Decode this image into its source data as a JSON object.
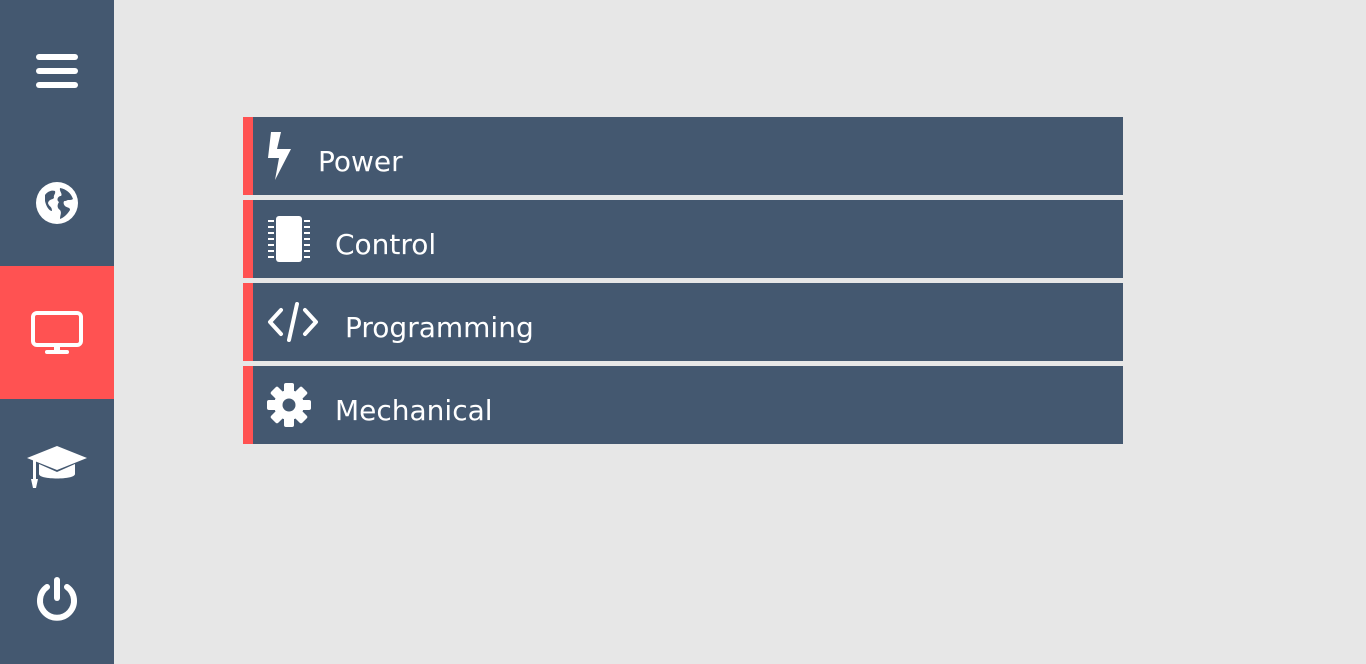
{
  "sidebar": {
    "items": [
      {
        "icon": "hamburger-menu-icon",
        "active": false
      },
      {
        "icon": "globe-icon",
        "active": false
      },
      {
        "icon": "monitor-icon",
        "active": true
      },
      {
        "icon": "graduation-cap-icon",
        "active": false
      },
      {
        "icon": "power-icon",
        "active": false
      }
    ]
  },
  "menu": {
    "items": [
      {
        "label": "Power",
        "icon": "lightning-bolt-icon"
      },
      {
        "label": "Control",
        "icon": "microchip-icon"
      },
      {
        "label": "Programming",
        "icon": "code-icon"
      },
      {
        "label": "Mechanical",
        "icon": "gear-icon"
      }
    ]
  },
  "colors": {
    "background": "#e7e7e7",
    "panel": "#445870",
    "accent": "#ff5252",
    "text": "#ffffff"
  }
}
